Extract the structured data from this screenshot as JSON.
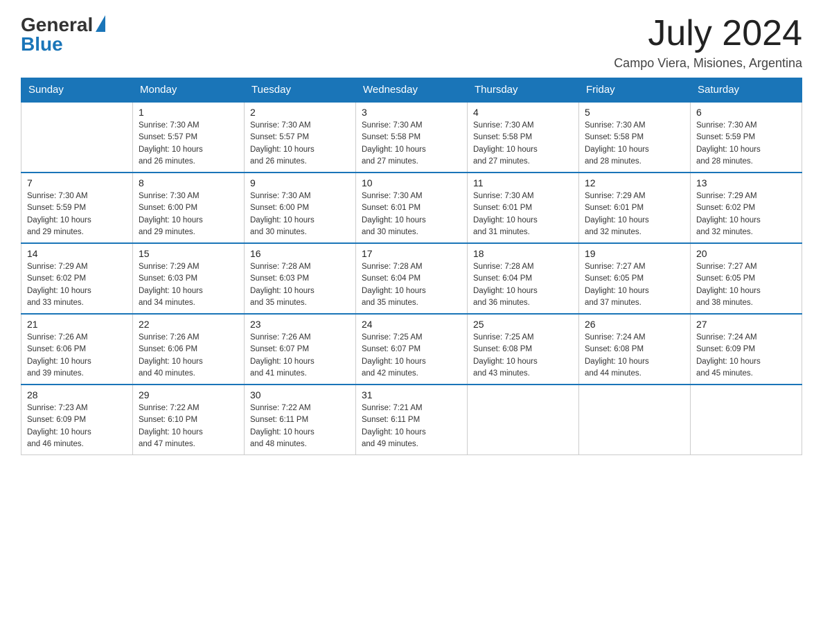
{
  "header": {
    "logo_general": "General",
    "logo_blue": "Blue",
    "title": "July 2024",
    "location": "Campo Viera, Misiones, Argentina"
  },
  "days_of_week": [
    "Sunday",
    "Monday",
    "Tuesday",
    "Wednesday",
    "Thursday",
    "Friday",
    "Saturday"
  ],
  "weeks": [
    [
      {
        "day": "",
        "info": ""
      },
      {
        "day": "1",
        "info": "Sunrise: 7:30 AM\nSunset: 5:57 PM\nDaylight: 10 hours\nand 26 minutes."
      },
      {
        "day": "2",
        "info": "Sunrise: 7:30 AM\nSunset: 5:57 PM\nDaylight: 10 hours\nand 26 minutes."
      },
      {
        "day": "3",
        "info": "Sunrise: 7:30 AM\nSunset: 5:58 PM\nDaylight: 10 hours\nand 27 minutes."
      },
      {
        "day": "4",
        "info": "Sunrise: 7:30 AM\nSunset: 5:58 PM\nDaylight: 10 hours\nand 27 minutes."
      },
      {
        "day": "5",
        "info": "Sunrise: 7:30 AM\nSunset: 5:58 PM\nDaylight: 10 hours\nand 28 minutes."
      },
      {
        "day": "6",
        "info": "Sunrise: 7:30 AM\nSunset: 5:59 PM\nDaylight: 10 hours\nand 28 minutes."
      }
    ],
    [
      {
        "day": "7",
        "info": "Sunrise: 7:30 AM\nSunset: 5:59 PM\nDaylight: 10 hours\nand 29 minutes."
      },
      {
        "day": "8",
        "info": "Sunrise: 7:30 AM\nSunset: 6:00 PM\nDaylight: 10 hours\nand 29 minutes."
      },
      {
        "day": "9",
        "info": "Sunrise: 7:30 AM\nSunset: 6:00 PM\nDaylight: 10 hours\nand 30 minutes."
      },
      {
        "day": "10",
        "info": "Sunrise: 7:30 AM\nSunset: 6:01 PM\nDaylight: 10 hours\nand 30 minutes."
      },
      {
        "day": "11",
        "info": "Sunrise: 7:30 AM\nSunset: 6:01 PM\nDaylight: 10 hours\nand 31 minutes."
      },
      {
        "day": "12",
        "info": "Sunrise: 7:29 AM\nSunset: 6:01 PM\nDaylight: 10 hours\nand 32 minutes."
      },
      {
        "day": "13",
        "info": "Sunrise: 7:29 AM\nSunset: 6:02 PM\nDaylight: 10 hours\nand 32 minutes."
      }
    ],
    [
      {
        "day": "14",
        "info": "Sunrise: 7:29 AM\nSunset: 6:02 PM\nDaylight: 10 hours\nand 33 minutes."
      },
      {
        "day": "15",
        "info": "Sunrise: 7:29 AM\nSunset: 6:03 PM\nDaylight: 10 hours\nand 34 minutes."
      },
      {
        "day": "16",
        "info": "Sunrise: 7:28 AM\nSunset: 6:03 PM\nDaylight: 10 hours\nand 35 minutes."
      },
      {
        "day": "17",
        "info": "Sunrise: 7:28 AM\nSunset: 6:04 PM\nDaylight: 10 hours\nand 35 minutes."
      },
      {
        "day": "18",
        "info": "Sunrise: 7:28 AM\nSunset: 6:04 PM\nDaylight: 10 hours\nand 36 minutes."
      },
      {
        "day": "19",
        "info": "Sunrise: 7:27 AM\nSunset: 6:05 PM\nDaylight: 10 hours\nand 37 minutes."
      },
      {
        "day": "20",
        "info": "Sunrise: 7:27 AM\nSunset: 6:05 PM\nDaylight: 10 hours\nand 38 minutes."
      }
    ],
    [
      {
        "day": "21",
        "info": "Sunrise: 7:26 AM\nSunset: 6:06 PM\nDaylight: 10 hours\nand 39 minutes."
      },
      {
        "day": "22",
        "info": "Sunrise: 7:26 AM\nSunset: 6:06 PM\nDaylight: 10 hours\nand 40 minutes."
      },
      {
        "day": "23",
        "info": "Sunrise: 7:26 AM\nSunset: 6:07 PM\nDaylight: 10 hours\nand 41 minutes."
      },
      {
        "day": "24",
        "info": "Sunrise: 7:25 AM\nSunset: 6:07 PM\nDaylight: 10 hours\nand 42 minutes."
      },
      {
        "day": "25",
        "info": "Sunrise: 7:25 AM\nSunset: 6:08 PM\nDaylight: 10 hours\nand 43 minutes."
      },
      {
        "day": "26",
        "info": "Sunrise: 7:24 AM\nSunset: 6:08 PM\nDaylight: 10 hours\nand 44 minutes."
      },
      {
        "day": "27",
        "info": "Sunrise: 7:24 AM\nSunset: 6:09 PM\nDaylight: 10 hours\nand 45 minutes."
      }
    ],
    [
      {
        "day": "28",
        "info": "Sunrise: 7:23 AM\nSunset: 6:09 PM\nDaylight: 10 hours\nand 46 minutes."
      },
      {
        "day": "29",
        "info": "Sunrise: 7:22 AM\nSunset: 6:10 PM\nDaylight: 10 hours\nand 47 minutes."
      },
      {
        "day": "30",
        "info": "Sunrise: 7:22 AM\nSunset: 6:11 PM\nDaylight: 10 hours\nand 48 minutes."
      },
      {
        "day": "31",
        "info": "Sunrise: 7:21 AM\nSunset: 6:11 PM\nDaylight: 10 hours\nand 49 minutes."
      },
      {
        "day": "",
        "info": ""
      },
      {
        "day": "",
        "info": ""
      },
      {
        "day": "",
        "info": ""
      }
    ]
  ]
}
